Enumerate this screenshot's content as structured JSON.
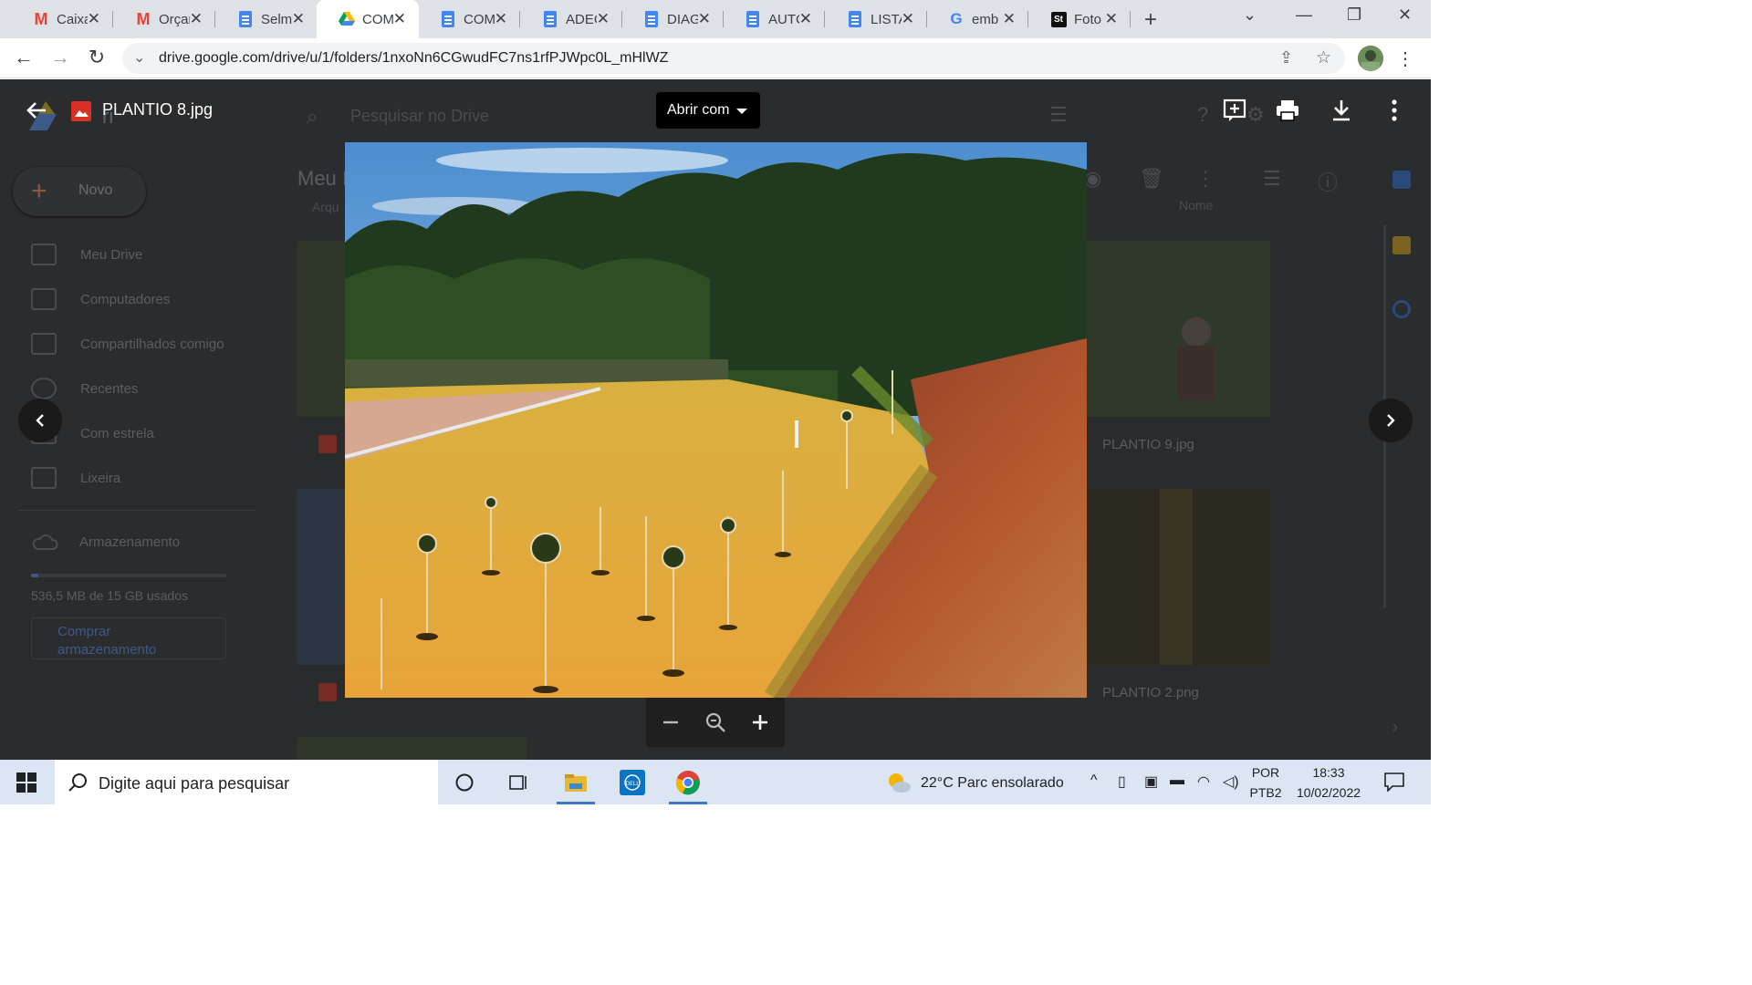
{
  "browser": {
    "tabs": [
      {
        "label": "Caixa",
        "icon": "gmail-icon",
        "active": false
      },
      {
        "label": "Orçar",
        "icon": "gmail-icon",
        "active": false
      },
      {
        "label": "Selm",
        "icon": "docs-icon",
        "active": false
      },
      {
        "label": "COM",
        "icon": "drive-icon",
        "active": true
      },
      {
        "label": "COM",
        "icon": "docs-icon",
        "active": false
      },
      {
        "label": "ADEC",
        "icon": "docs-icon",
        "active": false
      },
      {
        "label": "DIAG",
        "icon": "docs-icon",
        "active": false
      },
      {
        "label": "AUTC",
        "icon": "docs-icon",
        "active": false
      },
      {
        "label": "LISTA",
        "icon": "docs-icon",
        "active": false
      },
      {
        "label": "emb",
        "icon": "google-icon",
        "active": false
      },
      {
        "label": "Foto",
        "icon": "shutterstock-icon",
        "active": false
      }
    ],
    "url": "drive.google.com/drive/u/1/folders/1nxoNn6CGwudFC7ns1rfPJWpc0L_mHlWZ"
  },
  "drive": {
    "logo_partial": "ri",
    "search_placeholder": "Pesquisar no Drive",
    "new_label": "Novo",
    "folder_title_partial": "Meu I",
    "col_partial": "Arqu",
    "sort_label": "Nome",
    "sidebar": [
      {
        "label": "Meu Drive"
      },
      {
        "label": "Computadores"
      },
      {
        "label": "Compartilhados comigo"
      },
      {
        "label": "Recentes"
      },
      {
        "label": "Com estrela"
      },
      {
        "label": "Lixeira"
      }
    ],
    "storage_label": "Armazenamento",
    "storage_used": "536,5 MB de 15 GB usados",
    "storage_fraction": 0.036,
    "buy_storage": "Comprar armazenamento",
    "files": [
      {
        "name": "PLANTIO 9.jpg"
      },
      {
        "name": "PLANTIO 2.png"
      }
    ]
  },
  "viewer": {
    "title": "PLANTIO 8.jpg",
    "open_with": "Abrir com"
  },
  "taskbar": {
    "search_placeholder": "Digite aqui para pesquisar",
    "weather": "22°C  Parc ensolarado",
    "lang_top": "POR",
    "lang_bottom": "PTB2",
    "time": "18:33",
    "date": "10/02/2022"
  }
}
